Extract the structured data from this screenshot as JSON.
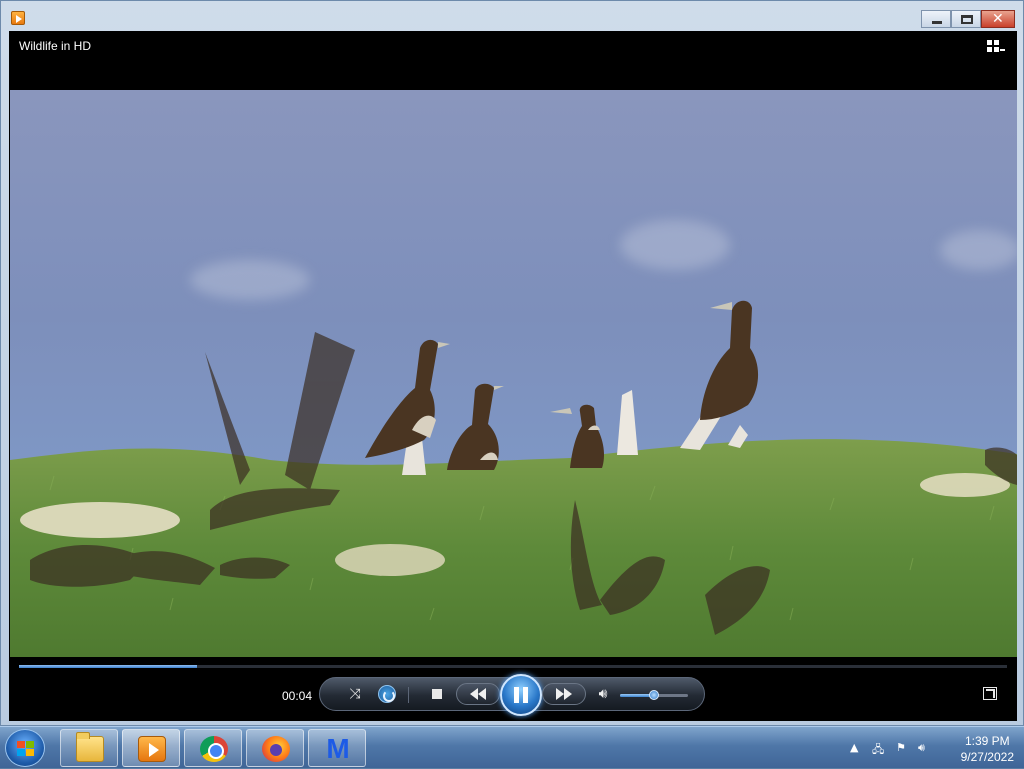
{
  "window": {
    "app_icon": "media-player-icon",
    "buttons": [
      "minimize-icon",
      "restore-icon",
      "close-icon"
    ]
  },
  "player": {
    "title": "Wildlife in HD",
    "switch_icon": "switch-to-library-icon",
    "time": "00:04",
    "progress_fraction": 0.18,
    "volume_fraction": 0.5,
    "controls": [
      "shuffle-icon",
      "repeat-icon",
      "stop-icon",
      "previous-icon",
      "pause-icon",
      "next-icon",
      "mute-icon",
      "fullscreen-icon"
    ]
  },
  "video": {
    "scene": "sky-grass-birds",
    "colors": {
      "sky": "#7f91bd",
      "grass": "#5e8a3a",
      "bird": "#4a3522"
    }
  },
  "taskbar": {
    "apps": [
      "folder-icon",
      "media-player-icon",
      "chrome-icon",
      "firefox-icon",
      "malwarebytes-icon"
    ],
    "clock_time": "1:39 PM",
    "clock_date": "9/27/2022"
  }
}
